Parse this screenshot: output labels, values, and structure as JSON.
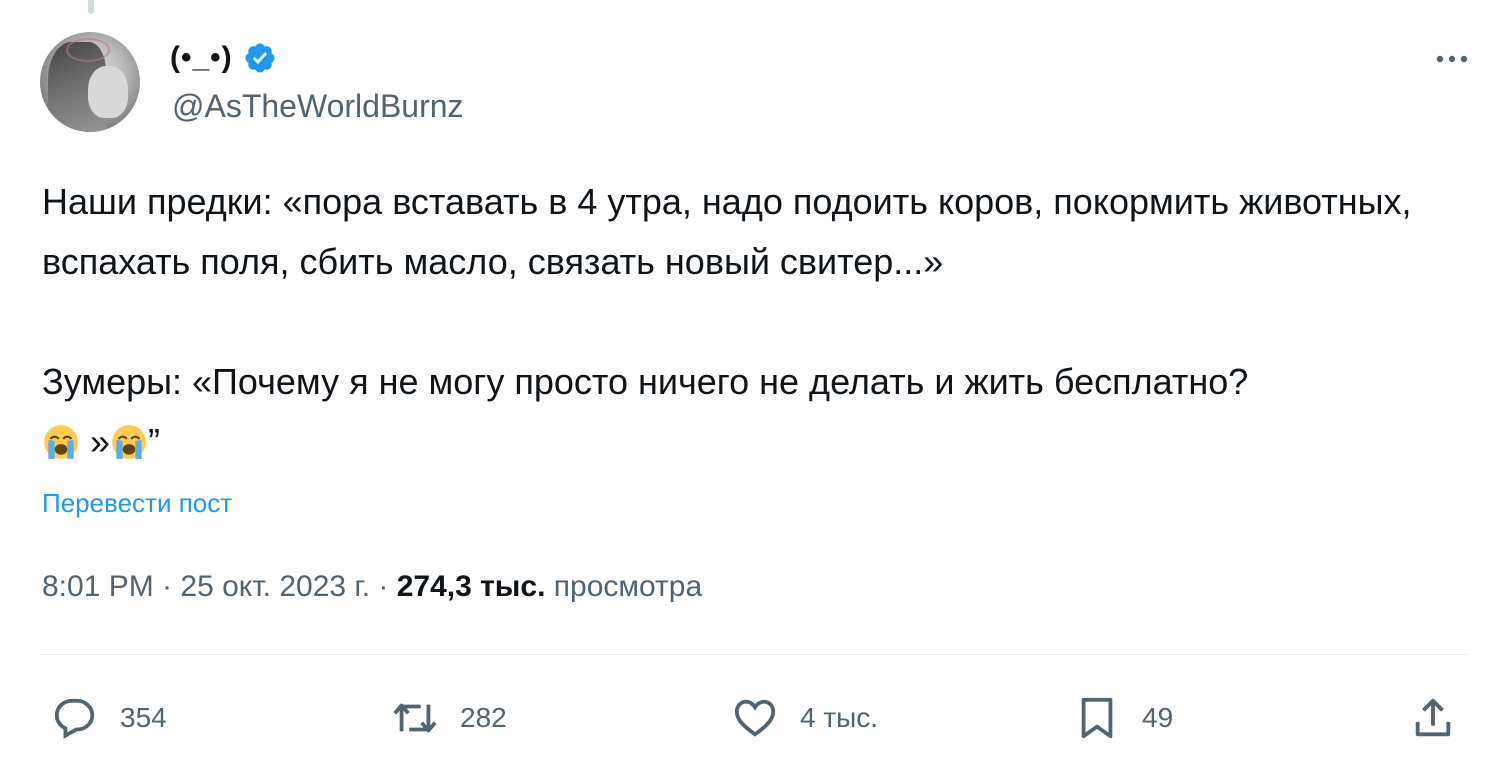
{
  "author": {
    "display_name": "(•_•)",
    "handle": "@AsTheWorldBurnz",
    "verified": true
  },
  "tweet": {
    "text": "Наши предки: «пора вставать в 4 утра, надо подоить коров, покормить животных, вспахать поля, сбить масло, связать новый свитер...»\n\nЗумеры: «Почему я не могу просто ничего не делать и жить бесплатно?",
    "emoji_tail_sep": " »",
    "emoji_tail_end": "”",
    "emoji": "loudly-crying-face",
    "translate_label": "Перевести пост"
  },
  "meta": {
    "time": "8:01 PM",
    "separator": " · ",
    "date": "25 окт. 2023 г.",
    "views_count": "274,3 тыс.",
    "views_label": "просмотра"
  },
  "actions": {
    "replies": "354",
    "reposts": "282",
    "likes": "4 тыс.",
    "bookmarks": "49"
  },
  "colors": {
    "accent": "#1d9bf0",
    "secondary_text": "#536471",
    "primary_text": "#0f1419"
  }
}
